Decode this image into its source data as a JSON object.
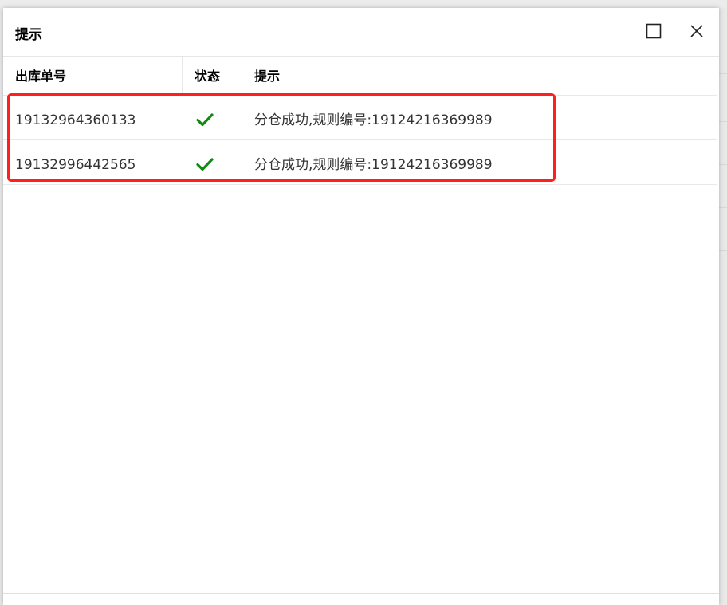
{
  "dialog": {
    "title": "提示",
    "maximize_icon": "maximize-icon",
    "close_icon": "close-icon"
  },
  "table": {
    "columns": [
      "出库单号",
      "状态",
      "提示"
    ],
    "rows": [
      {
        "order_no": "19132964360133",
        "status_icon": "check-icon",
        "message": "分仓成功,规则编号:19124216369989"
      },
      {
        "order_no": "19132996442565",
        "status_icon": "check-icon",
        "message": "分仓成功,规则编号:19124216369989"
      }
    ]
  },
  "colors": {
    "check": "#118a11",
    "highlight": "#ff1f1f"
  }
}
